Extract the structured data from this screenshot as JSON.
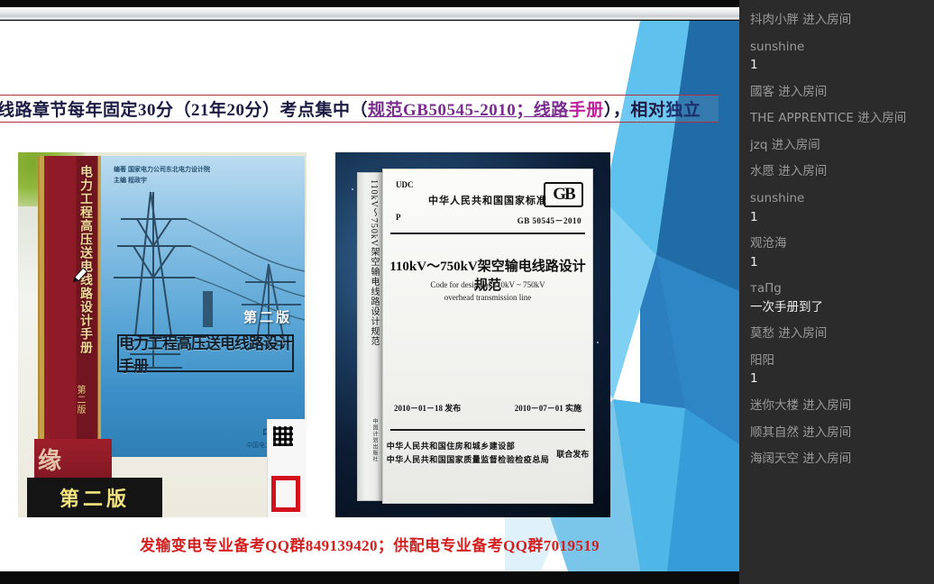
{
  "slide": {
    "headline": {
      "part1": "线路章节每年固定30分（21年20分）考点集中（",
      "part2": "规范GB50545-2010；线路",
      "part3": "手册",
      "part4": "），相对",
      "part5": "独立",
      "border_color": "#b03040"
    },
    "caption": "发输变电专业备考QQ群849139420；供配电专业备考QQ群7019519",
    "caption_color": "#d41f1f",
    "left_book": {
      "spine_title": "电力工程高压送电线路设计手册",
      "spine_edition": "第二版",
      "credit_line1": "编著 国家电力公司东北电力设计院",
      "credit_line2": "主编 程政宇",
      "edition_badge": "第二版",
      "cover_title": "电力工程高压送电线路设计手册",
      "publisher": "中国电力出版社",
      "publisher_mark": "中",
      "stack_text": "缘",
      "black_band": "第二版"
    },
    "right_book": {
      "udc": "UDC",
      "p": "P",
      "national_standard": "中华人民共和国国家标准",
      "gb_logo": "GB",
      "code": "GB 50545－2010",
      "main_title": "110kV～750kV架空输电线路设计规范",
      "sub_title_line1": "Code for design of 110kV ~ 750kV",
      "sub_title_line2": "overhead transmission line",
      "issue_date": "2010－01－18  发布",
      "effective_date": "2010－07－01  实施",
      "issuer_line1": "中华人民共和国住房和城乡建设部",
      "issuer_line2": "中华人民共和国国家质量监督检验检疫总局",
      "joint": "联合发布",
      "spine_title": "110kV～750kV架空输电线路设计规范",
      "spine_publisher": "中国计划出版社"
    }
  },
  "chat": {
    "messages": [
      {
        "user": "抖肉小胖",
        "action": "进入房间",
        "text": ""
      },
      {
        "user": "sunshine",
        "action": "",
        "text": "1"
      },
      {
        "user": "國客",
        "action": "进入房间",
        "text": ""
      },
      {
        "user": "THE APPRENTICE",
        "action": "进入房间",
        "text": ""
      },
      {
        "user": "jzq",
        "action": "进入房间",
        "text": ""
      },
      {
        "user": "水愿",
        "action": "进入房间",
        "text": ""
      },
      {
        "user": "sunshine",
        "action": "",
        "text": "1"
      },
      {
        "user": "观沧海",
        "action": "",
        "text": "1"
      },
      {
        "user": "ᴛaПg",
        "action": "",
        "text": "一次手册到了"
      },
      {
        "user": "莫愁",
        "action": "进入房间",
        "text": ""
      },
      {
        "user": "阳阳",
        "action": "",
        "text": "1"
      },
      {
        "user": "迷你大楼",
        "action": "进入房间",
        "text": ""
      },
      {
        "user": "顺其自然",
        "action": "进入房间",
        "text": ""
      },
      {
        "user": "海阔天空",
        "action": "进入房间",
        "text": ""
      }
    ],
    "background_color": "#2b2b2b",
    "username_color": "#9a9a9a",
    "message_color": "#f0f0f0"
  }
}
